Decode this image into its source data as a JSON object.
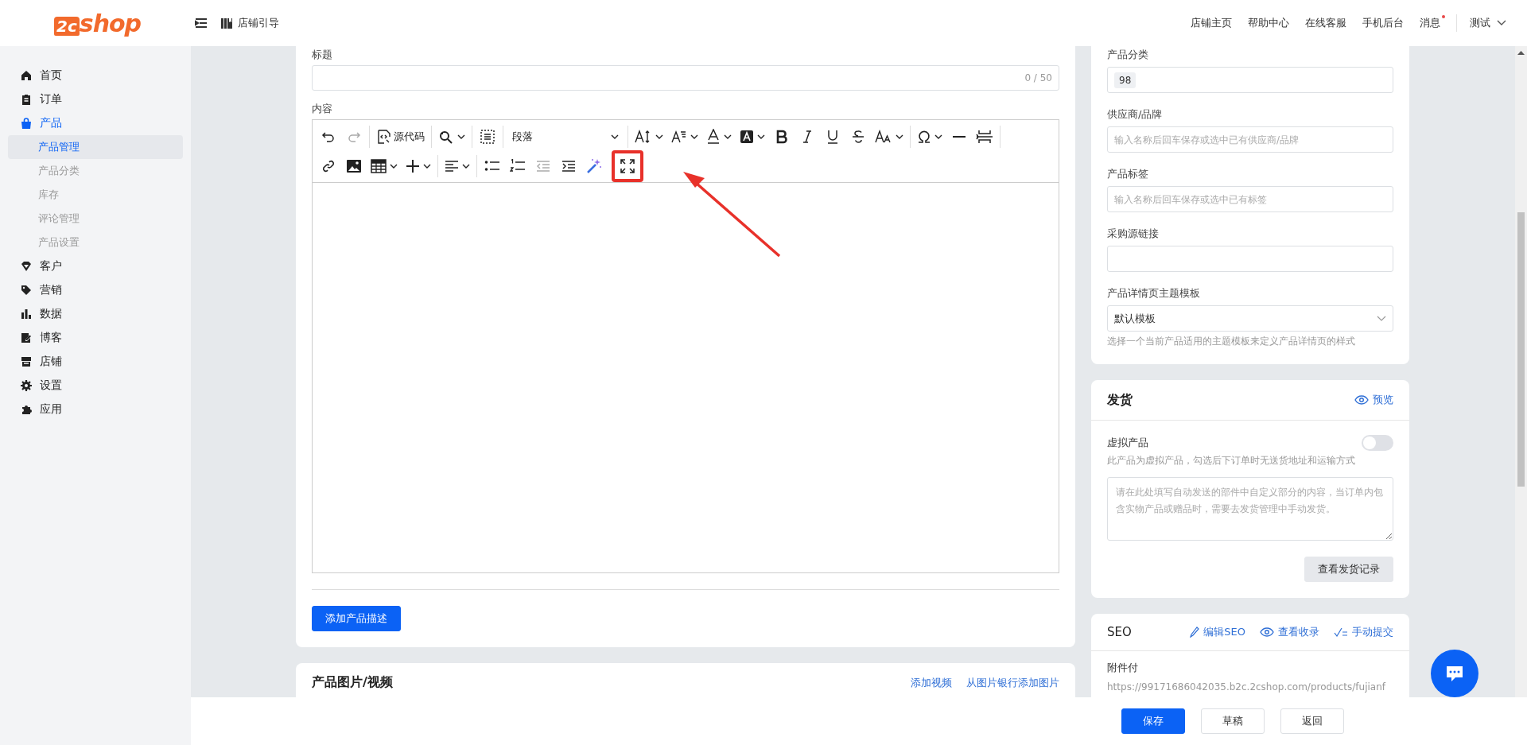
{
  "header": {
    "logo": {
      "mark": "2c",
      "word": "shop"
    },
    "guide_link": "店铺引导",
    "nav": [
      {
        "label": "店铺主页",
        "unread": false
      },
      {
        "label": "帮助中心",
        "unread": false
      },
      {
        "label": "在线客服",
        "unread": false
      },
      {
        "label": "手机后台",
        "unread": false
      },
      {
        "label": "消息",
        "unread": true
      }
    ],
    "user": "测试"
  },
  "sidebar": {
    "items": [
      {
        "label": "首页",
        "expanded": false
      },
      {
        "label": "订单",
        "expanded": false
      },
      {
        "label": "产品",
        "expanded": true,
        "children": [
          {
            "label": "产品管理",
            "selected": true
          },
          {
            "label": "产品分类",
            "selected": false
          },
          {
            "label": "库存",
            "selected": false
          },
          {
            "label": "评论管理",
            "selected": false
          },
          {
            "label": "产品设置",
            "selected": false
          }
        ]
      },
      {
        "label": "客户",
        "expanded": false
      },
      {
        "label": "营销",
        "expanded": false
      },
      {
        "label": "数据",
        "expanded": false
      },
      {
        "label": "博客",
        "expanded": false
      },
      {
        "label": "店铺",
        "expanded": false
      },
      {
        "label": "设置",
        "expanded": false
      },
      {
        "label": "应用",
        "expanded": false
      }
    ]
  },
  "description_card": {
    "title_label": "标题",
    "title_counter": "0 / 50",
    "content_label": "内容",
    "toolbar": {
      "source_code": "源代码",
      "block_format": "段落",
      "redo_disabled": true,
      "fullscreen_highlighted": true
    },
    "add_button": "添加产品描述"
  },
  "media_card": {
    "title": "产品图片/视频",
    "links": [
      "添加视频",
      "从图片银行添加图片"
    ]
  },
  "organize_card": {
    "fields": [
      {
        "kind": "tags",
        "label": "产品分类",
        "tags": [
          "98"
        ]
      },
      {
        "kind": "input",
        "label": "供应商/品牌",
        "placeholder": "输入名称后回车保存或选中已有供应商/品牌"
      },
      {
        "kind": "input",
        "label": "产品标签",
        "placeholder": "输入名称后回车保存或选中已有标签"
      },
      {
        "kind": "input",
        "label": "采购源链接"
      },
      {
        "kind": "select",
        "label": "产品详情页主题模板",
        "value": "默认模板",
        "hint": "选择一个当前产品适用的主题模板来定义产品详情页的样式"
      }
    ]
  },
  "shipping_card": {
    "title": "发货",
    "preview_link": "预览",
    "virtual_label": "虚拟产品",
    "virtual_on": false,
    "virtual_hint": "此产品为虚拟产品，勾选后下订单时无送货地址和运输方式",
    "note_placeholder": "请在此处填写自动发送的部件中自定义部分的内容，当订单内包含实物产品或赠品时，需要去发货管理中手动发货。",
    "records_button": "查看发货记录"
  },
  "seo_card": {
    "title": "SEO",
    "links": [
      "编辑SEO",
      "查看收录",
      "手动提交"
    ],
    "field_label": "附件付",
    "url": "https://99171686042035.b2c.2cshop.com/products/fujianf"
  },
  "footer": {
    "buttons": [
      {
        "label": "保存",
        "primary": true
      },
      {
        "label": "草稿",
        "primary": false
      },
      {
        "label": "返回",
        "primary": false
      }
    ]
  }
}
